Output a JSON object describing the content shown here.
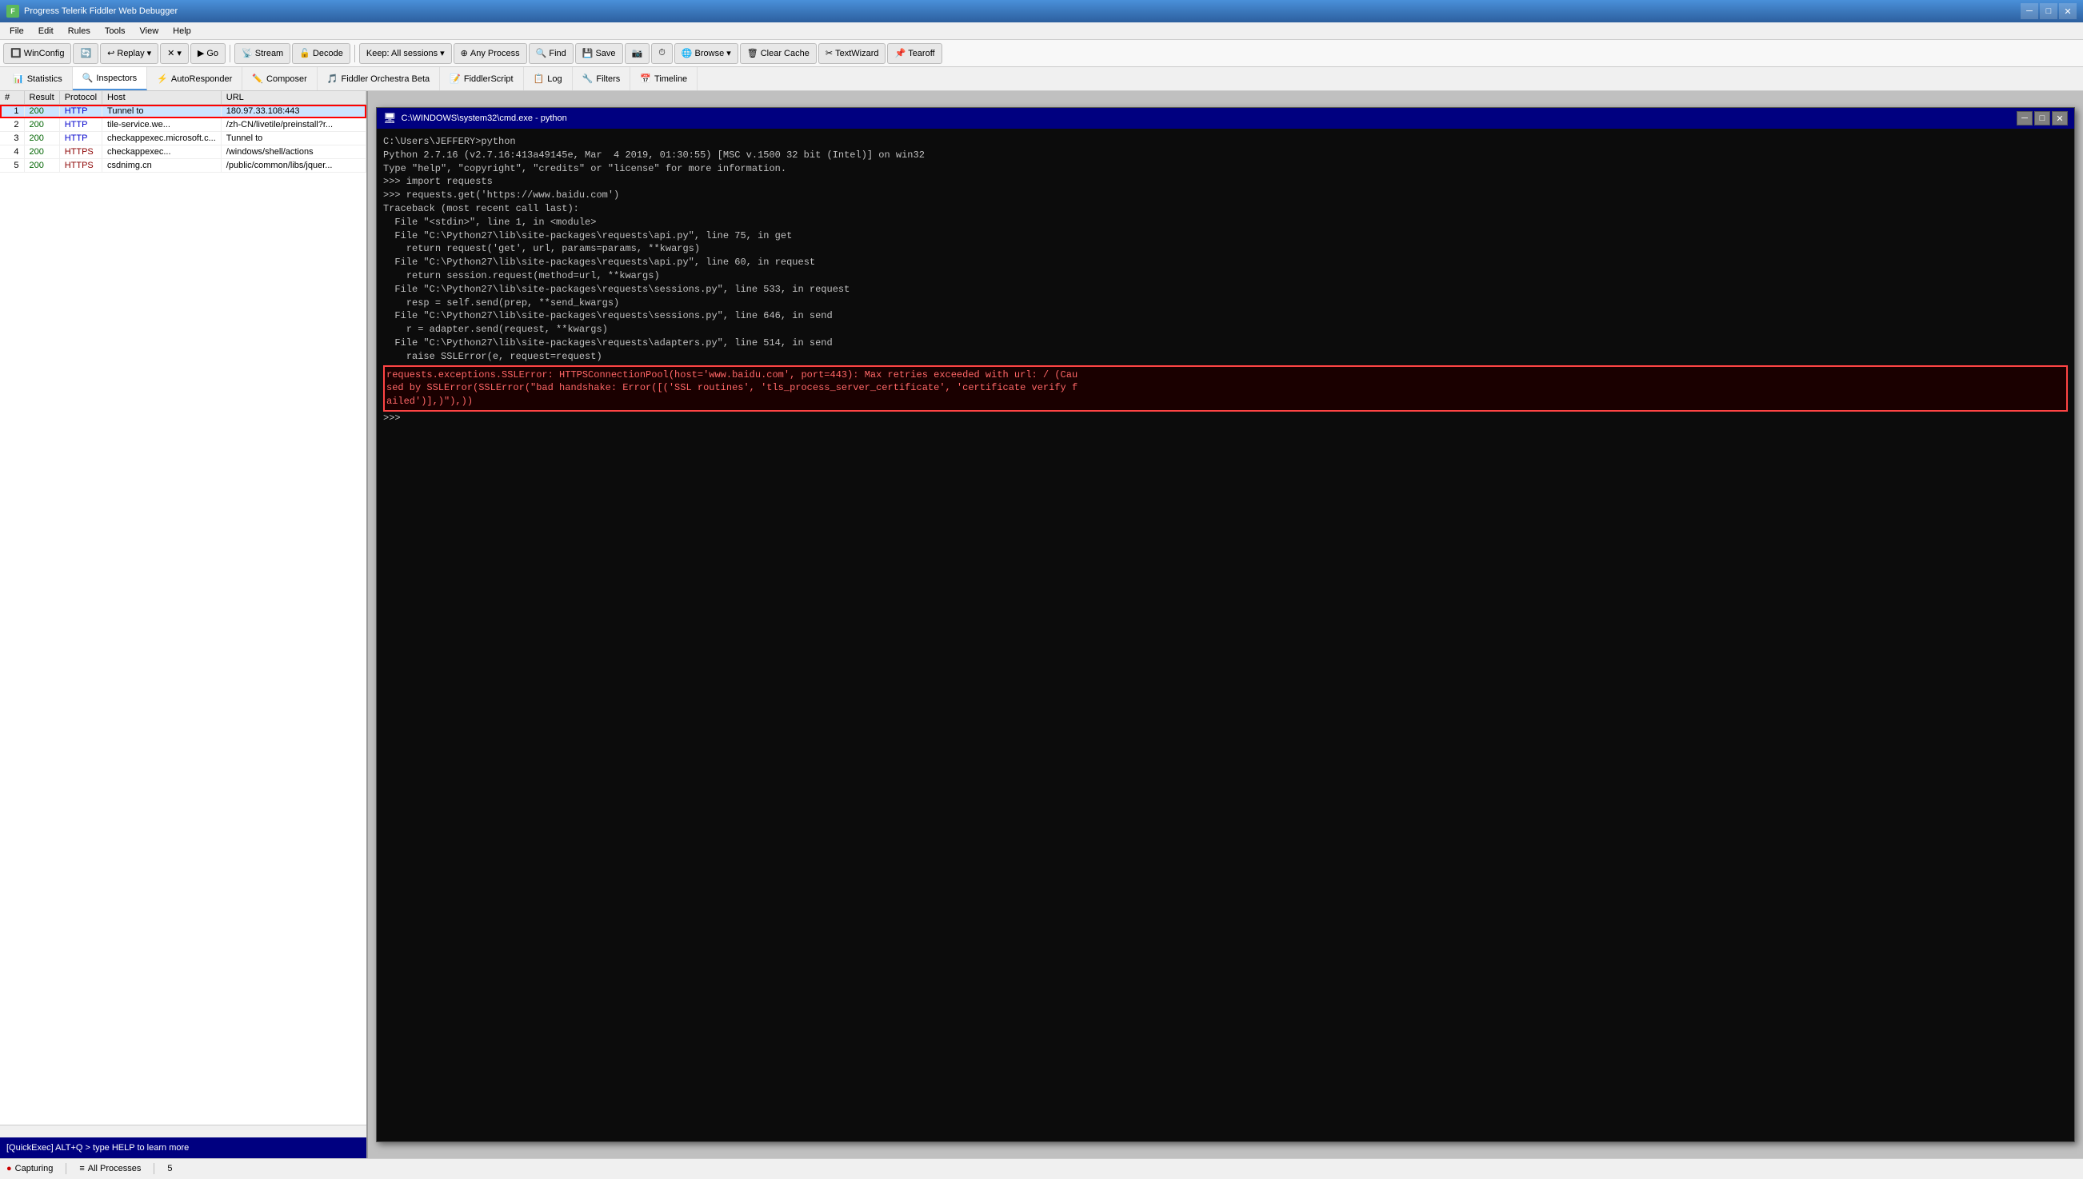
{
  "titleBar": {
    "icon": "F",
    "title": "Progress Telerik Fiddler Web Debugger",
    "minimizeLabel": "─",
    "maximizeLabel": "□",
    "closeLabel": "✕"
  },
  "menuBar": {
    "items": [
      "File",
      "Edit",
      "Rules",
      "Tools",
      "View",
      "Help"
    ]
  },
  "toolbar": {
    "winconfig": "WinConfig",
    "replay": "Replay",
    "go": "Go",
    "stream": "Stream",
    "decode": "Decode",
    "keepLabel": "Keep: All sessions",
    "anyProcess": "Any Process",
    "find": "Find",
    "save": "Save",
    "browse": "Browse",
    "clearCache": "Clear Cache",
    "textWizard": "TextWizard",
    "tearoff": "Tearoff"
  },
  "tabs": [
    {
      "id": "statistics",
      "label": "Statistics",
      "icon": "📊"
    },
    {
      "id": "inspectors",
      "label": "Inspectors",
      "icon": "🔍"
    },
    {
      "id": "autoresponder",
      "label": "AutoResponder",
      "icon": "⚡"
    },
    {
      "id": "composer",
      "label": "Composer",
      "icon": "✏️"
    },
    {
      "id": "fiddler-orchestra",
      "label": "Fiddler Orchestra Beta",
      "icon": "🎵"
    },
    {
      "id": "fiddlerscript",
      "label": "FiddlerScript",
      "icon": "📝"
    },
    {
      "id": "log",
      "label": "Log",
      "icon": "📋"
    },
    {
      "id": "filters",
      "label": "Filters",
      "icon": "🔧"
    },
    {
      "id": "timeline",
      "label": "Timeline",
      "icon": "📅"
    }
  ],
  "sessionTable": {
    "headers": [
      "#",
      "Result",
      "Protocol",
      "Host",
      "URL"
    ],
    "rows": [
      {
        "num": "1",
        "result": "200",
        "protocol": "HTTP",
        "host": "Tunnel to",
        "url": "180.97.33.108:443",
        "selected": true
      },
      {
        "num": "2",
        "result": "200",
        "protocol": "HTTP",
        "host": "tile-service.we...",
        "url": "/zh-CN/livetile/preinstall?r..."
      },
      {
        "num": "3",
        "result": "200",
        "protocol": "HTTP",
        "host": "checkappexec.microsoft.c...",
        "url": "Tunnel to"
      },
      {
        "num": "4",
        "result": "200",
        "protocol": "HTTPS",
        "host": "checkappexec...",
        "url": "/windows/shell/actions"
      },
      {
        "num": "5",
        "result": "200",
        "protocol": "HTTPS",
        "host": "csdnimg.cn",
        "url": "/public/common/libs/jquer..."
      }
    ]
  },
  "cmdWindow": {
    "title": "C:\\WINDOWS\\system32\\cmd.exe - python",
    "content": [
      "C:\\Users\\JEFFERY>python",
      "Python 2.7.16 (v2.7.16:413a49145e, Mar  4 2019, 01:30:55) [MSC v.1500 32 bit (Intel)] on win32",
      "Type \"help\", \"copyright\", \"credits\" or \"license\" for more information.",
      ">>> import requests",
      ">>> requests.get('https://www.baidu.com')",
      "Traceback (most recent call last):",
      "  File \"<stdin>\", line 1, in <module>",
      "  File \"C:\\Python27\\lib\\site-packages\\requests\\api.py\", line 75, in get",
      "    return request('get', url, params=params, **kwargs)",
      "  File \"C:\\Python27\\lib\\site-packages\\requests\\api.py\", line 60, in request",
      "    return session.request(method=url, **kwargs)",
      "  File \"C:\\Python27\\lib\\site-packages\\requests\\sessions.py\", line 533, in request",
      "    resp = self.send(prep, **send_kwargs)",
      "  File \"C:\\Python27\\lib\\site-packages\\requests\\sessions.py\", line 646, in send",
      "    r = adapter.send(request, **kwargs)",
      "  File \"C:\\Python27\\lib\\site-packages\\requests\\adapters.py\", line 514, in send",
      "    raise SSLError(e, request=request)"
    ],
    "errorLines": [
      "requests.exceptions.SSLError: HTTPSConnectionPool(host='www.baidu.com', port=443): Max retries exceeded with url: / (Cau",
      "sed by SSLError(SSLError(\"bad handshake: Error([('SSL routines', 'tls_process_server_certificate', 'certificate verify f",
      "ailed')],)\"),))"
    ],
    "prompt": ">>>"
  },
  "quickExec": {
    "text": "[QuickExec] ALT+Q > type HELP to learn more"
  },
  "statusBar": {
    "capturing": "Capturing",
    "allProcesses": "All Processes",
    "sessionCount": "5"
  }
}
